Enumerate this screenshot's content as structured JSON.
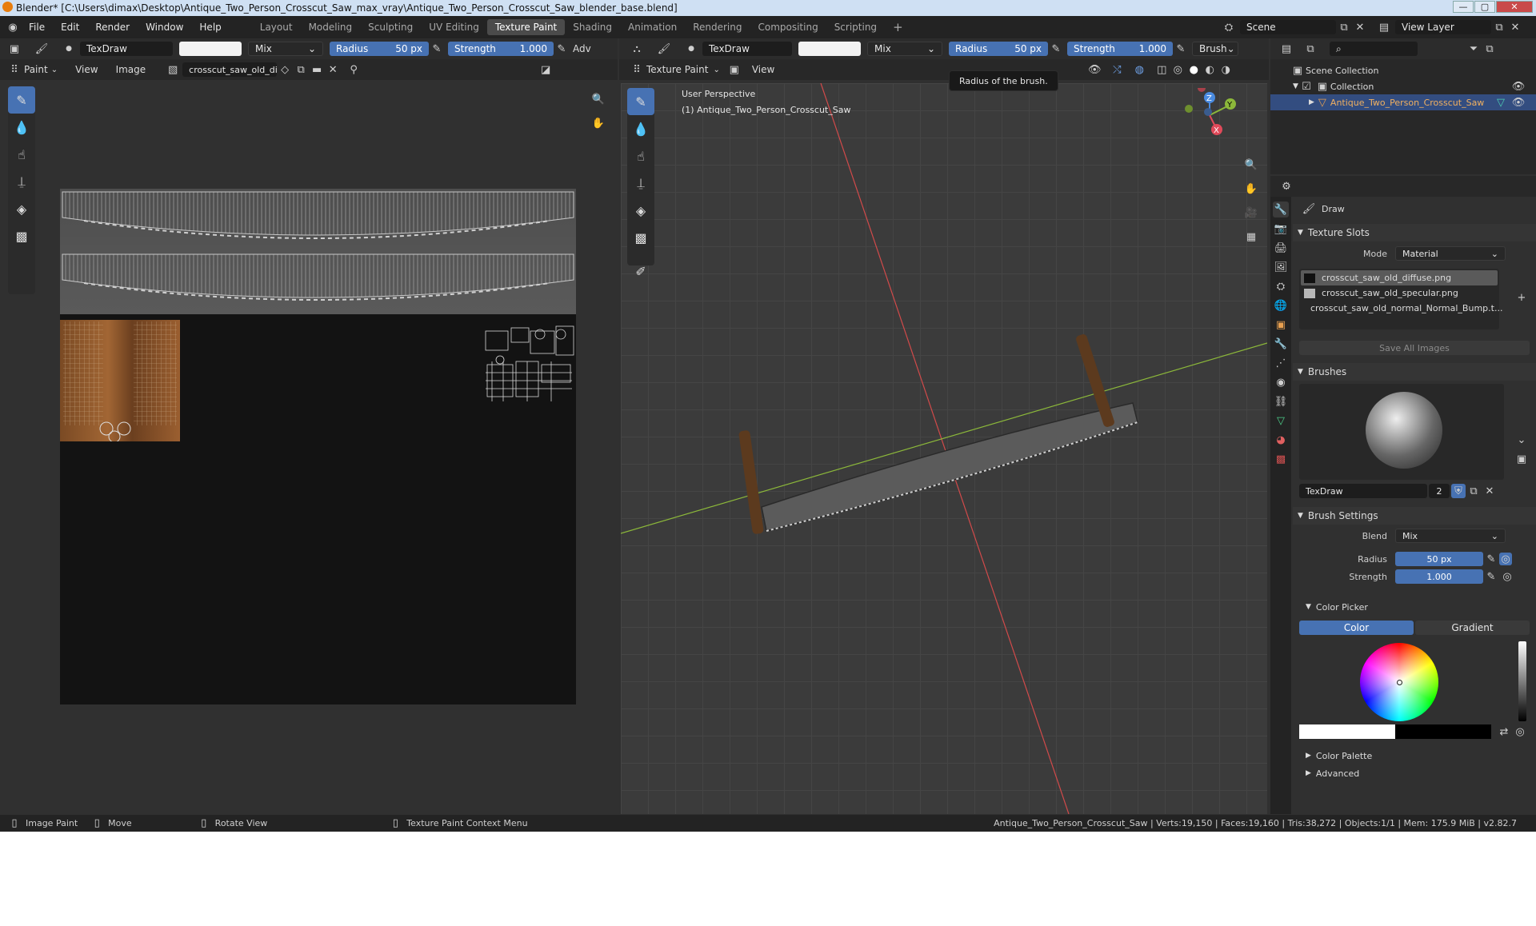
{
  "window": {
    "title": "Blender* [C:\\Users\\dimax\\Desktop\\Antique_Two_Person_Crosscut_Saw_max_vray\\Antique_Two_Person_Crosscut_Saw_blender_base.blend]"
  },
  "menus": [
    "File",
    "Edit",
    "Render",
    "Window",
    "Help"
  ],
  "workspaces": [
    "Layout",
    "Modeling",
    "Sculpting",
    "UV Editing",
    "Texture Paint",
    "Shading",
    "Animation",
    "Rendering",
    "Compositing",
    "Scripting"
  ],
  "active_workspace": "Texture Paint",
  "scene": {
    "name": "Scene",
    "view_layer": "View Layer"
  },
  "image_editor": {
    "brush_name": "TexDraw",
    "blend": "Mix",
    "radius_label": "Radius",
    "radius_value": "50 px",
    "strength_label": "Strength",
    "strength_value": "1.000",
    "adv_label": "Adv",
    "mode": "Paint",
    "view_menu": "View",
    "image_menu": "Image",
    "image_name": "crosscut_saw_old_di..."
  },
  "viewport": {
    "brush_name": "TexDraw",
    "blend": "Mix",
    "radius_label": "Radius",
    "radius_value": "50 px",
    "strength_label": "Strength",
    "strength_value": "1.000",
    "brush_menu": "Brush",
    "mode": "Texture Paint",
    "view_menu": "View",
    "perspective": "User Perspective",
    "object": "(1) Antique_Two_Person_Crosscut_Saw",
    "tooltip": "Radius of the brush.",
    "axes": {
      "x": "X",
      "y": "Y",
      "z": "Z"
    }
  },
  "outliner": {
    "scene_collection": "Scene Collection",
    "collection": "Collection",
    "object": "Antique_Two_Person_Crosscut_Saw"
  },
  "properties": {
    "tool_name": "Draw",
    "texture_slots": {
      "title": "Texture Slots",
      "mode_label": "Mode",
      "mode_value": "Material",
      "slots": [
        "crosscut_saw_old_diffuse.png",
        "crosscut_saw_old_specular.png",
        "crosscut_saw_old_normal_Normal_Bump.t..."
      ],
      "save_all": "Save All Images"
    },
    "brushes": {
      "title": "Brushes",
      "brush_name": "TexDraw",
      "users": "2"
    },
    "brush_settings": {
      "title": "Brush Settings",
      "blend_label": "Blend",
      "blend_value": "Mix",
      "radius_label": "Radius",
      "radius_value": "50 px",
      "strength_label": "Strength",
      "strength_value": "1.000"
    },
    "color_picker": {
      "title": "Color Picker",
      "tab_color": "Color",
      "tab_gradient": "Gradient"
    },
    "color_palette": "Color Palette",
    "advanced": "Advanced"
  },
  "statusbar": {
    "left": [
      "Image Paint",
      "Move",
      "Rotate View",
      "Texture Paint Context Menu"
    ],
    "right": "Antique_Two_Person_Crosscut_Saw | Verts:19,150 | Faces:19,160 | Tris:38,272 | Objects:1/1 | Mem: 175.9 MiB | v2.82.7"
  },
  "colors": {
    "accent": "#4772b3",
    "background": "#303030",
    "header": "#232323"
  }
}
